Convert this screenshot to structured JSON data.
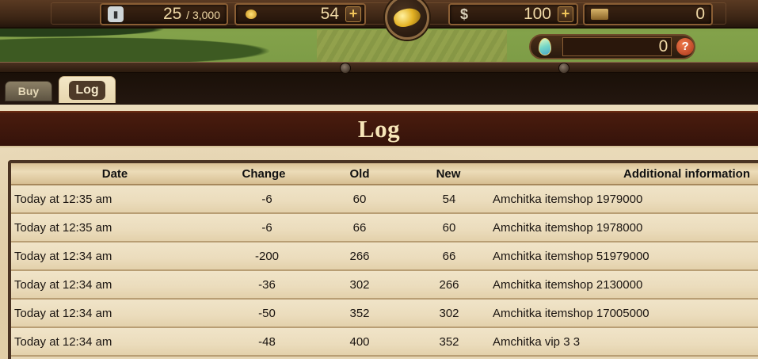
{
  "hud": {
    "energy": {
      "icon": "energy-card-icon",
      "value": "25",
      "max": "/ 3,000"
    },
    "nuggets": {
      "icon": "gold-nugget-icon",
      "value": "54"
    },
    "dollars": {
      "icon": "dollar-icon",
      "symbol": "$",
      "value": "100"
    },
    "bonds": {
      "icon": "bond-chest-icon",
      "value": "0"
    },
    "eggs": {
      "icon": "egg-icon",
      "value": "0"
    },
    "help_label": "?",
    "plus_label": "+"
  },
  "tabs": [
    {
      "label": "Buy",
      "active": false
    },
    {
      "label": "Log",
      "active": true
    }
  ],
  "page_title": "Log",
  "table": {
    "headers": {
      "date": "Date",
      "change": "Change",
      "old": "Old",
      "new": "New",
      "info": "Additional information"
    },
    "rows": [
      {
        "date": "Today at 12:35 am",
        "change": "-6",
        "old": "60",
        "new": "54",
        "info": "Amchitka itemshop 1979000"
      },
      {
        "date": "Today at 12:35 am",
        "change": "-6",
        "old": "66",
        "new": "60",
        "info": "Amchitka itemshop 1978000"
      },
      {
        "date": "Today at 12:34 am",
        "change": "-200",
        "old": "266",
        "new": "66",
        "info": "Amchitka itemshop 51979000"
      },
      {
        "date": "Today at 12:34 am",
        "change": "-36",
        "old": "302",
        "new": "266",
        "info": "Amchitka itemshop 2130000"
      },
      {
        "date": "Today at 12:34 am",
        "change": "-50",
        "old": "352",
        "new": "302",
        "info": "Amchitka itemshop 17005000"
      },
      {
        "date": "Today at 12:34 am",
        "change": "-48",
        "old": "400",
        "new": "352",
        "info": "Amchitka vip 3 3"
      }
    ]
  },
  "colors": {
    "title_band": "#35130a",
    "title_text": "#f7e6b8",
    "resource_text": "#f0d9a6",
    "parchment": "#ebdcbc"
  }
}
